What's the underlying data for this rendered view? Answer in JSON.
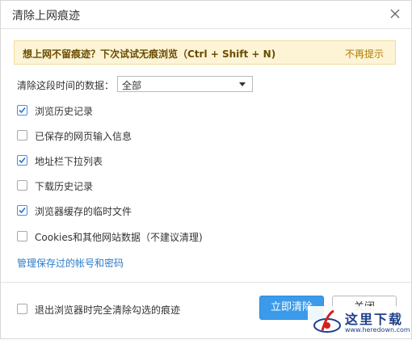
{
  "dialog": {
    "title": "清除上网痕迹"
  },
  "banner": {
    "text": "想上网不留痕迹？下次试试无痕浏览（Ctrl + Shift + N)",
    "dismiss_link": "不再提示",
    "background": "#fdf4d6"
  },
  "time_range": {
    "label": "清除这段时间的数据：",
    "selected": "全部"
  },
  "options": [
    {
      "label": "浏览历史记录",
      "checked": true
    },
    {
      "label": "已保存的网页输入信息",
      "checked": false
    },
    {
      "label": "地址栏下拉列表",
      "checked": true
    },
    {
      "label": "下载历史记录",
      "checked": false
    },
    {
      "label": "浏览器缓存的临时文件",
      "checked": true
    },
    {
      "label": "Cookies和其他网站数据（不建议清理)",
      "checked": false
    }
  ],
  "manage_link": "管理保存过的帐号和密码",
  "footer": {
    "exit_option": {
      "label": "退出浏览器时完全清除勾选的痕迹",
      "checked": false
    },
    "clear_button": "立即清除",
    "close_button": "关闭"
  },
  "watermark": {
    "text": "这里下载",
    "url": "www.heredown.com"
  },
  "colors": {
    "accent": "#3b9bea",
    "link": "#2b7bc8",
    "checkbox_checked": "#4a8de0"
  }
}
